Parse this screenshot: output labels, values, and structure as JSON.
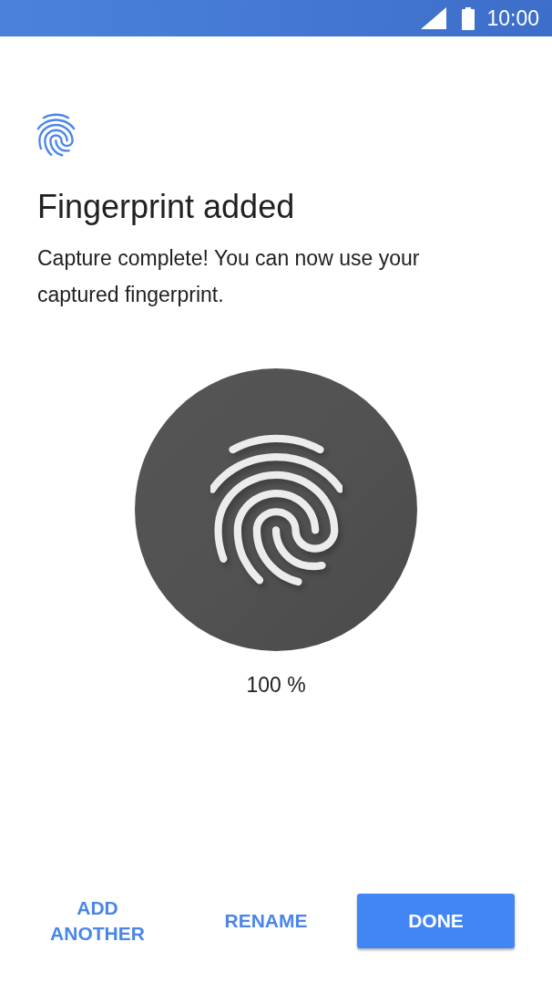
{
  "status_bar": {
    "time": "10:00"
  },
  "header": {
    "title": "Fingerprint added",
    "message": "Capture complete! You can now use your captured fingerprint."
  },
  "progress": {
    "reading": "100 %"
  },
  "buttons": [
    {
      "label": "ADD ANOTHER",
      "kind": "text"
    },
    {
      "label": "RENAME",
      "kind": "text"
    },
    {
      "label": "DONE",
      "kind": "filled"
    }
  ]
}
